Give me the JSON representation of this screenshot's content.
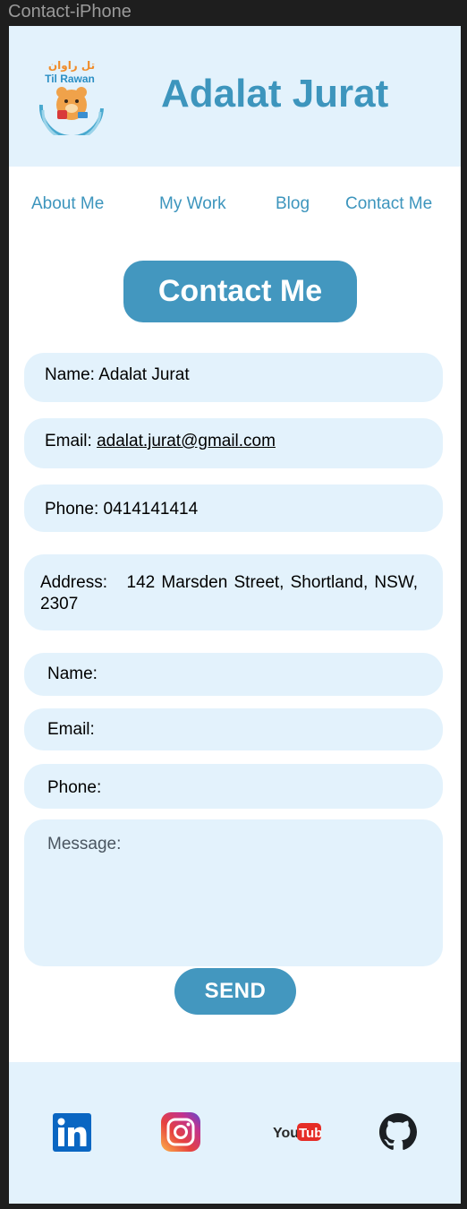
{
  "window": {
    "title": "Contact-iPhone"
  },
  "header": {
    "logo": {
      "icon": "til-rawan-logo",
      "arabic_text": "تل راوان",
      "latin_text": "Til Rawan"
    },
    "title": "Adalat Jurat"
  },
  "nav": {
    "items": [
      {
        "label": "About Me"
      },
      {
        "label": "My Work"
      },
      {
        "label": "Blog"
      },
      {
        "label": "Contact Me"
      }
    ]
  },
  "contact": {
    "heading": "Contact Me",
    "name_label": "Name:",
    "name_value": "Adalat Jurat",
    "email_label": "Email:",
    "email_value": "adalat.jurat@gmail.com",
    "phone_label": "Phone:",
    "phone_value": "0414141414",
    "address_label": "Address:",
    "address_value": "142 Marsden Street, Shortland, NSW, 2307"
  },
  "form": {
    "name_label": "Name:",
    "email_label": "Email:",
    "phone_label": "Phone:",
    "message_label": "Message:",
    "send_label": "SEND"
  },
  "footer": {
    "social": [
      {
        "name": "LinkedIn",
        "icon": "linkedin-icon",
        "color": "#0a66c2"
      },
      {
        "name": "Instagram",
        "icon": "instagram-icon",
        "color": "#d6249f"
      },
      {
        "name": "YouTube",
        "icon": "youtube-icon",
        "color": "#e52d27"
      },
      {
        "name": "GitHub",
        "icon": "github-icon",
        "color": "#1b1f23"
      }
    ]
  },
  "colors": {
    "accent": "#3d95bd",
    "button": "#4397bf",
    "light_bg": "#e3f2fc",
    "frame_bg": "#1e1e1e"
  }
}
